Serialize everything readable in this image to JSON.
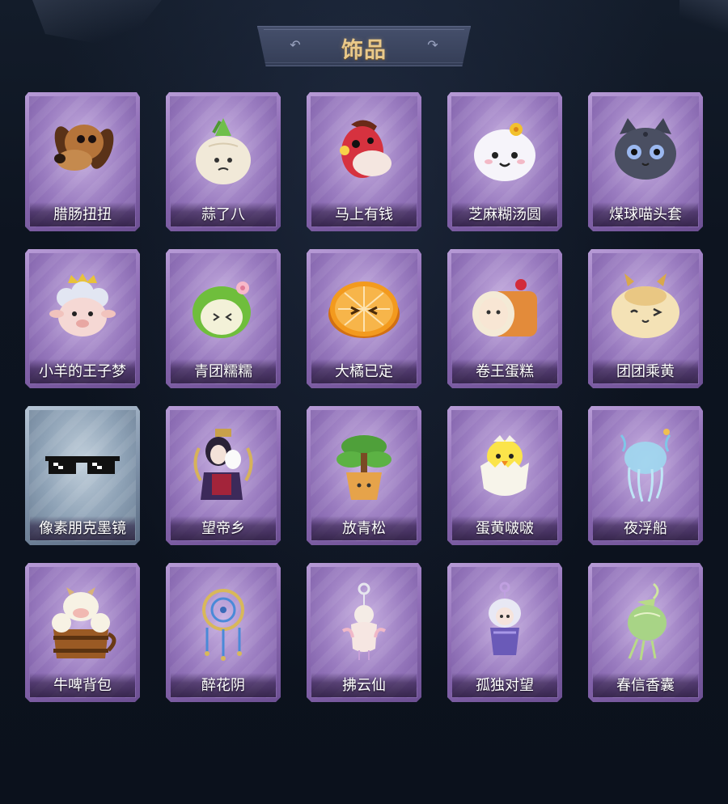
{
  "header": {
    "title": "饰品",
    "left_flourish_icon": "scroll-flourish-icon",
    "right_flourish_icon": "scroll-flourish-icon"
  },
  "colors": {
    "background": "#0d1420",
    "card_purple": "#9a7cc0",
    "card_blue": "#8ea2b6",
    "title_gold": "#e9c98a"
  },
  "items": [
    {
      "name": "腊肠扭扭",
      "icon": "dachshund-head-icon",
      "rarity": "purple"
    },
    {
      "name": "蒜了八",
      "icon": "garlic-bulb-icon",
      "rarity": "purple"
    },
    {
      "name": "马上有钱",
      "icon": "red-horse-head-icon",
      "rarity": "purple"
    },
    {
      "name": "芝麻糊汤圆",
      "icon": "rice-dumpling-flower-icon",
      "rarity": "purple"
    },
    {
      "name": "煤球喵头套",
      "icon": "black-cat-head-icon",
      "rarity": "purple"
    },
    {
      "name": "小羊的王子梦",
      "icon": "crowned-sheep-icon",
      "rarity": "purple"
    },
    {
      "name": "青团糯糯",
      "icon": "green-rice-ball-icon",
      "rarity": "purple"
    },
    {
      "name": "大橘已定",
      "icon": "orange-slice-face-icon",
      "rarity": "purple"
    },
    {
      "name": "卷王蛋糕",
      "icon": "swiss-roll-cake-icon",
      "rarity": "purple"
    },
    {
      "name": "团团乘黄",
      "icon": "horned-cat-bun-icon",
      "rarity": "purple"
    },
    {
      "name": "像素朋克墨镜",
      "icon": "pixel-sunglasses-icon",
      "rarity": "blue"
    },
    {
      "name": "望帝乡",
      "icon": "masked-figure-icon",
      "rarity": "purple"
    },
    {
      "name": "放青松",
      "icon": "potted-pine-icon",
      "rarity": "purple"
    },
    {
      "name": "蛋黄啵啵",
      "icon": "chick-in-egg-icon",
      "rarity": "purple"
    },
    {
      "name": "夜浮船",
      "icon": "jellyfish-icon",
      "rarity": "purple"
    },
    {
      "name": "牛啤背包",
      "icon": "cow-beer-mug-icon",
      "rarity": "purple"
    },
    {
      "name": "醉花阴",
      "icon": "dreamcatcher-icon",
      "rarity": "purple"
    },
    {
      "name": "拂云仙",
      "icon": "cloud-fairy-charm-icon",
      "rarity": "purple"
    },
    {
      "name": "孤独对望",
      "icon": "hanging-doll-charm-icon",
      "rarity": "purple"
    },
    {
      "name": "春信香囊",
      "icon": "green-sachet-icon",
      "rarity": "purple"
    }
  ]
}
